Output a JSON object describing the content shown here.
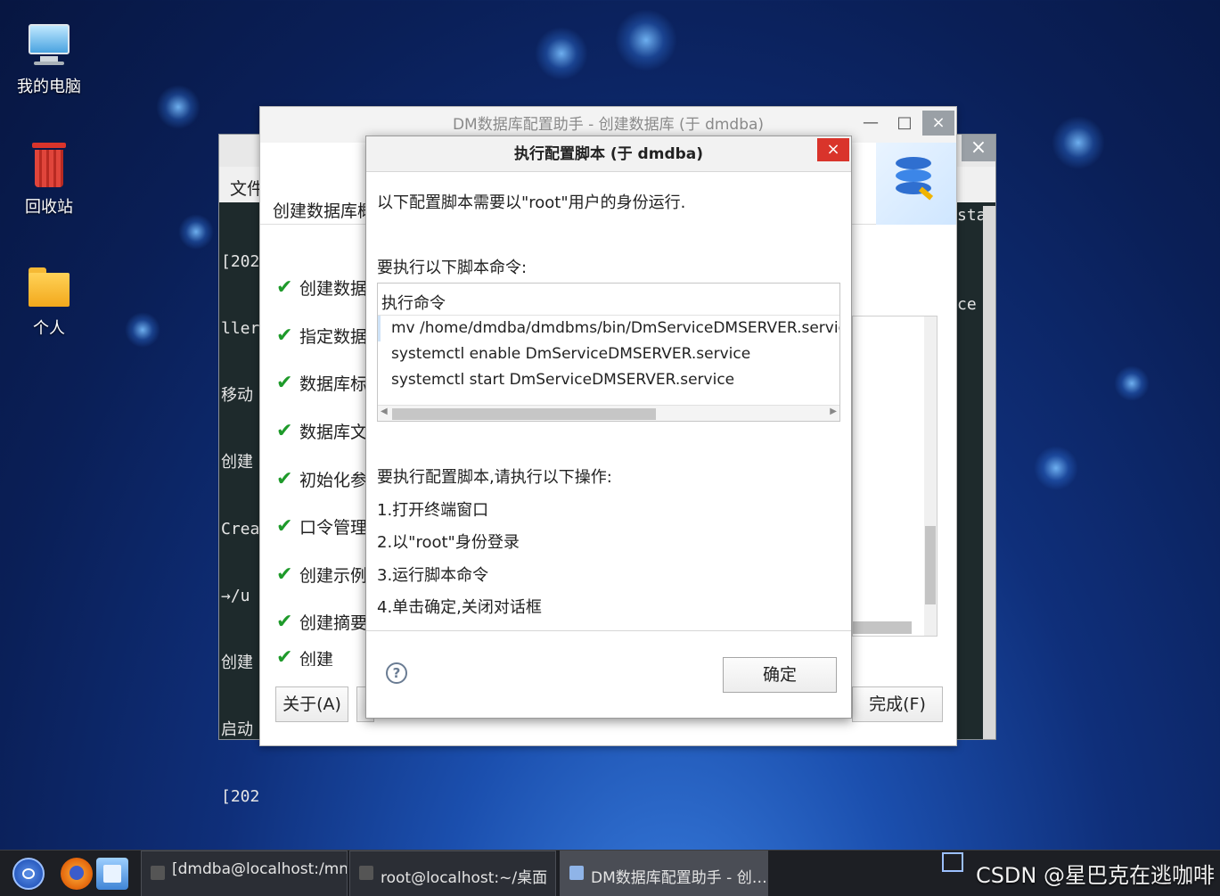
{
  "desktop": {
    "icons": [
      {
        "label": "我的电脑"
      },
      {
        "label": "回收站"
      },
      {
        "label": "个人"
      }
    ]
  },
  "terminal": {
    "menu_file": "文件",
    "lines": [
      "[202",
      "ller",
      "移动",
      "创建",
      "Crea",
      "→/u",
      "创建",
      "启动",
      "[202"
    ],
    "right_text_1": "sta",
    "right_text_2": "ce",
    "close": "×"
  },
  "dm_window": {
    "title": "DM数据库配置助手 - 创建数据库 (于 dmdba)",
    "subtitle": "创建数据库概要",
    "steps": [
      {
        "label": "创建数据库"
      },
      {
        "label": "指定数据库"
      },
      {
        "label": "数据库标识"
      },
      {
        "label": "数据库文件"
      },
      {
        "label": "初始化参数"
      },
      {
        "label": "口令管理"
      },
      {
        "label": "创建示例库"
      },
      {
        "label": "创建摘要"
      },
      {
        "label": "创建"
      }
    ],
    "about_button": "关于(A)",
    "finish_button": "完成(F)",
    "minimize": "—",
    "maximize": "□",
    "close": "×"
  },
  "dialog": {
    "title": "执行配置脚本 (于 dmdba)",
    "close": "×",
    "intro": "以下配置脚本需要以\"root\"用户的身份运行.",
    "cmd_label": "要执行以下脚本命令:",
    "cmd_header": "执行命令",
    "commands": [
      "mv /home/dmdba/dmdbms/bin/DmServiceDMSERVER.service /usr/lib/sys",
      "systemctl enable DmServiceDMSERVER.service",
      "systemctl start DmServiceDMSERVER.service"
    ],
    "steps_label": "要执行配置脚本,请执行以下操作:",
    "instructions": [
      "1.打开终端窗口",
      "2.以\"root\"身份登录",
      "3.运行脚本命令",
      "4.单击确定,关闭对话框"
    ],
    "help": "?",
    "ok_button": "确定"
  },
  "taskbar": {
    "tasks": [
      {
        "label": "[dmdba@localhost:/mnt]"
      },
      {
        "label": "root@localhost:~/桌面"
      },
      {
        "label": "DM数据库配置助手 - 创…"
      }
    ]
  },
  "watermark": "CSDN @星巴克在逃咖啡"
}
